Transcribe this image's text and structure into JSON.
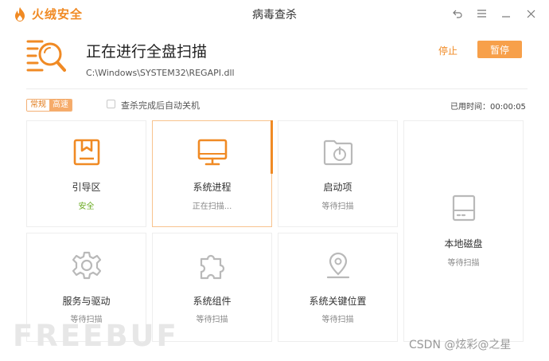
{
  "app": {
    "brand_name": "火绒安全",
    "window_title": "病毒查杀",
    "brand_color": "#f08a24"
  },
  "window_controls": {
    "back_icon": "↶",
    "menu_icon": "☰",
    "minimize_icon": "—",
    "close_icon": "✕"
  },
  "scan": {
    "title": "正在进行全盘扫描",
    "current_path": "C:\\Windows\\SYSTEM32\\REGAPI.dll",
    "stop_label": "停止",
    "pause_label": "暂停"
  },
  "options": {
    "mode_normal_label": "常规",
    "mode_fast_label": "高速",
    "auto_shutdown_label": "查杀完成后自动关机",
    "auto_shutdown_checked": false,
    "elapsed_label": "已用时间：",
    "elapsed_value": "00:00:05"
  },
  "cards": [
    {
      "name": "引导区",
      "status": "安全",
      "icon": "boot-icon"
    },
    {
      "name": "系统进程",
      "status": "正在扫描...",
      "icon": "monitor-icon"
    },
    {
      "name": "启动项",
      "status": "等待扫描",
      "icon": "startup-folder-icon"
    },
    {
      "name": "本地磁盘",
      "status": "等待扫描",
      "icon": "disk-icon"
    },
    {
      "name": "服务与驱动",
      "status": "等待扫描",
      "icon": "gear-icon"
    },
    {
      "name": "系统组件",
      "status": "等待扫描",
      "icon": "puzzle-icon"
    },
    {
      "name": "系统关键位置",
      "status": "等待扫描",
      "icon": "location-pin-icon"
    }
  ],
  "watermarks": {
    "left": "FREEBUF",
    "right": "CSDN @炫彩@之星"
  }
}
